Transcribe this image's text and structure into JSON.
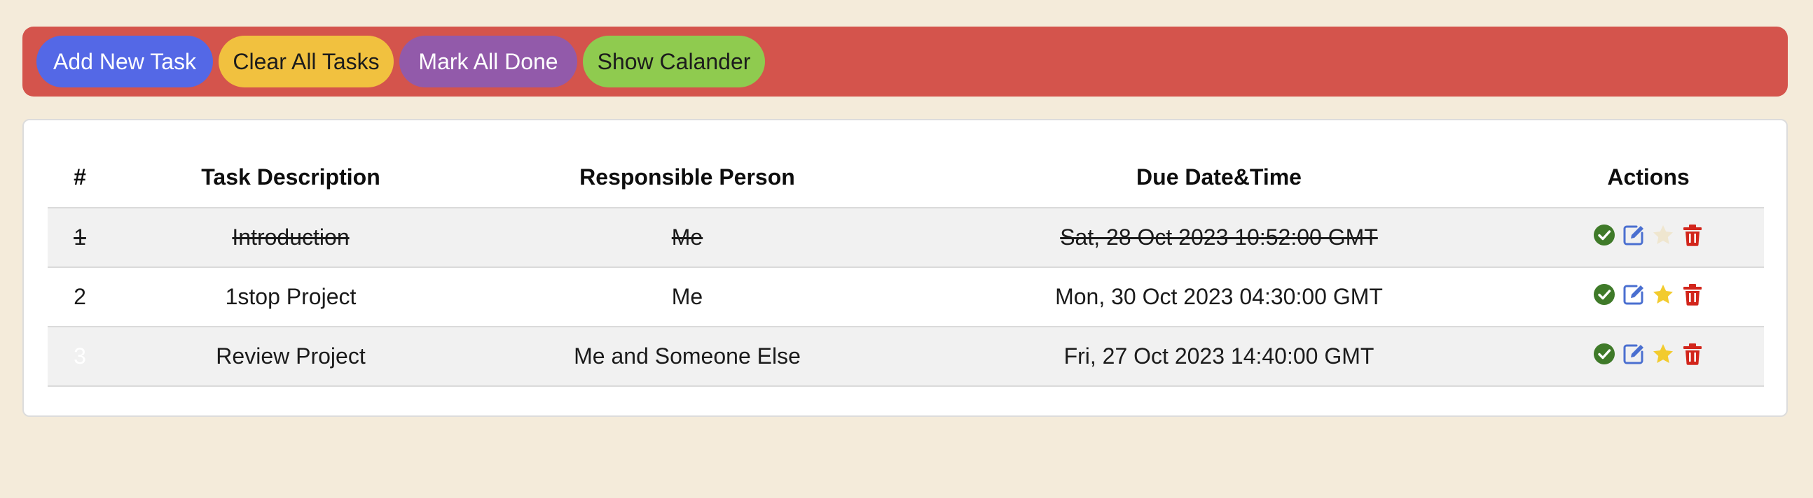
{
  "toolbar": {
    "buttons": [
      {
        "label": "Add New Task",
        "color": "#5468e6"
      },
      {
        "label": "Clear All Tasks",
        "color": "#f1c13f"
      },
      {
        "label": "Mark All Done",
        "color": "#925aaa"
      },
      {
        "label": "Show Calander",
        "color": "#8fcb4f"
      }
    ]
  },
  "table": {
    "headers": {
      "number": "#",
      "description": "Task Description",
      "person": "Responsible Person",
      "due": "Due Date&Time",
      "actions": "Actions"
    },
    "rows": [
      {
        "number": "1",
        "description": "Introduction",
        "person": "Me",
        "due": "Sat, 28 Oct 2023 10:52:00 GMT",
        "completed": true,
        "starred": false,
        "highlighted": false,
        "icons": [
          "check-icon",
          "edit-icon",
          "star-icon",
          "trash-icon"
        ]
      },
      {
        "number": "2",
        "description": "1stop Project",
        "person": "Me",
        "due": "Mon, 30 Oct 2023 04:30:00 GMT",
        "completed": false,
        "starred": true,
        "highlighted": false,
        "icons": [
          "check-icon",
          "edit-icon",
          "star-icon",
          "trash-icon"
        ]
      },
      {
        "number": "3",
        "description": "Review Project",
        "person": "Me and Someone Else",
        "due": "Fri, 27 Oct 2023 14:40:00 GMT",
        "completed": false,
        "starred": true,
        "highlighted": true,
        "icons": [
          "check-icon",
          "edit-icon",
          "star-icon",
          "trash-icon"
        ]
      }
    ]
  },
  "colors": {
    "page_background": "#f4ebda",
    "toolbar_background": "#d4544c",
    "check": "#3f7a29",
    "edit": "#4a6fd0",
    "star_active": "#f2cb2e",
    "star_inactive": "#efe6cf",
    "trash": "#d2261c",
    "row_highlight": "#2417e2"
  }
}
